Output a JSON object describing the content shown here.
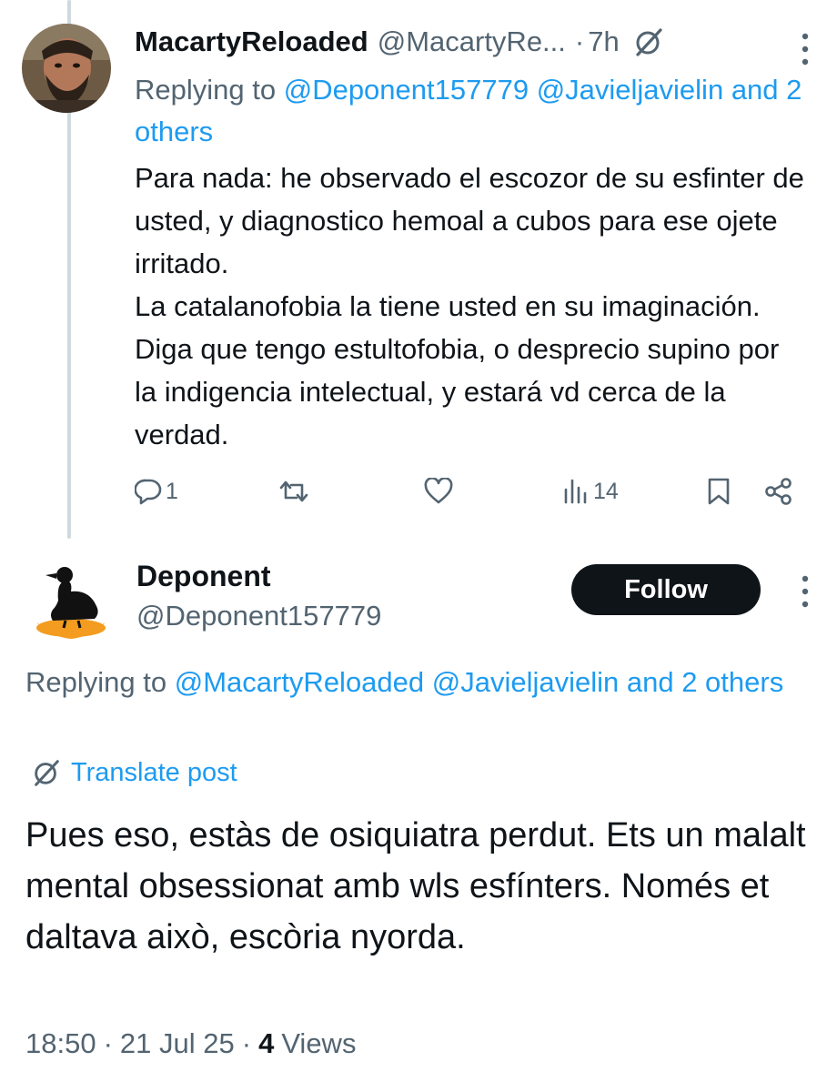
{
  "colors": {
    "text": "#0f1419",
    "secondary": "#536471",
    "link": "#1d9bf0",
    "thread_line": "#cfd9de",
    "follow_button_bg": "#0f1419",
    "follow_button_text": "#ffffff",
    "duck_accent": "#f39c1f"
  },
  "post1": {
    "display_name": "MacartyReloaded",
    "handle": "@MacartyRe...",
    "separator": "·",
    "time": "7h",
    "grok_icon": "grok-slash-icon",
    "more_icon": "more-vertical-icon",
    "replying_prefix": "Replying to",
    "replying_mentions": "@Deponent157779 @Javieljavielin",
    "replying_suffix": "and 2 others",
    "paragraph1": "Para nada: he observado el escozor de su esfinter de usted, y diagnostico hemoal a cubos para ese ojete irritado.",
    "paragraph2": "La catalanofobia la tiene usted en su imaginación. Diga que tengo estultofobia, o desprecio supino por la indigencia intelectual, y estará vd cerca de la verdad.",
    "actions": {
      "reply_count": "1",
      "repost_count": "",
      "like_count": "",
      "views_count": "14"
    }
  },
  "post2": {
    "display_name": "Deponent",
    "handle": "@Deponent157779",
    "follow_label": "Follow",
    "more_icon": "more-vertical-icon",
    "replying_prefix": "Replying to",
    "replying_mentions": "@MacartyReloaded @Javieljavielin and 2 others",
    "translate_label": "Translate post",
    "body": "Pues eso, estàs de osiquiatra perdut. Ets un malalt mental obsessionat amb wls esfínters. Només et daltava això, escòria nyorda.",
    "time": "18:50",
    "date": "21 Jul 25",
    "separator": "·",
    "views_number": "4",
    "views_label": "Views"
  }
}
